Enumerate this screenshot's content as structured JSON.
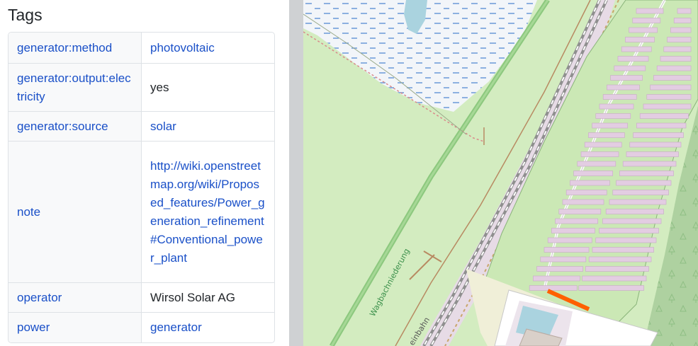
{
  "sidebar": {
    "title": "Tags",
    "rows": [
      {
        "key": "generator:method",
        "value": "photovoltaic",
        "value_is_link": true
      },
      {
        "key": "generator:output:electricity",
        "value": "yes",
        "value_is_link": false
      },
      {
        "key": "generator:source",
        "value": "solar",
        "value_is_link": true
      },
      {
        "key": "note",
        "value": "http://wiki.openstreetmap.org/wiki/Proposed_features/Power_generation_refinement#Conventional_power_plant",
        "value_is_link": true
      },
      {
        "key": "operator",
        "value": "Wirsol Solar AG",
        "value_is_link": false
      },
      {
        "key": "power",
        "value": "generator",
        "value_is_link": true
      }
    ]
  },
  "map": {
    "labels": {
      "waterway": "Wagbachniederung",
      "railway": "einbahn"
    },
    "colors": {
      "link": "#1a50c8",
      "highlight": "#ff6000",
      "solar_panel": "#e3cde2",
      "water": "#aad3df",
      "grass": "#d3ecc0"
    }
  }
}
